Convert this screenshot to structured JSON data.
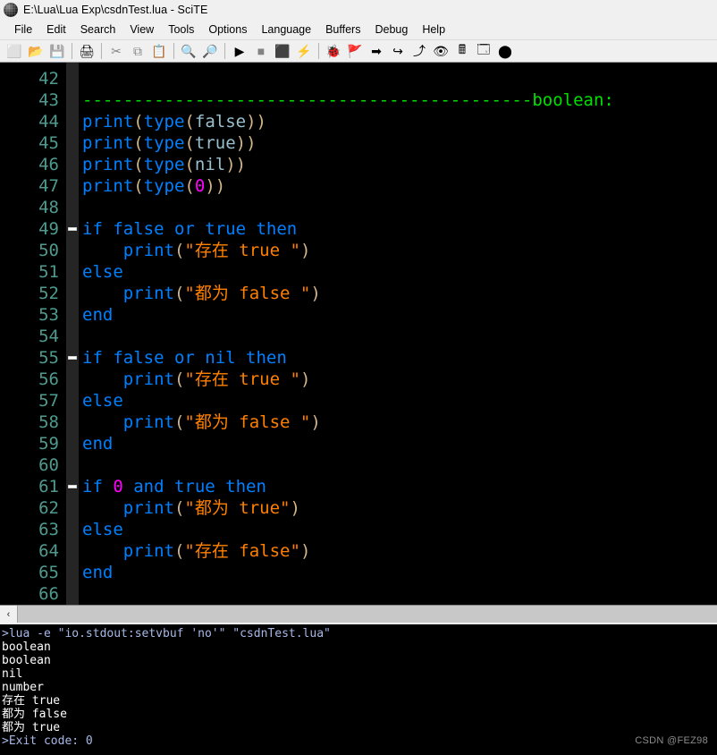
{
  "window": {
    "title": "E:\\Lua\\Lua Exp\\csdnTest.lua - SciTE",
    "app_icon": "sphere-icon"
  },
  "menubar": {
    "items": [
      {
        "label": "File"
      },
      {
        "label": "Edit"
      },
      {
        "label": "Search"
      },
      {
        "label": "View"
      },
      {
        "label": "Tools"
      },
      {
        "label": "Options"
      },
      {
        "label": "Language"
      },
      {
        "label": "Buffers"
      },
      {
        "label": "Debug"
      },
      {
        "label": "Help"
      }
    ]
  },
  "toolbar": {
    "buttons": [
      {
        "name": "new-file-icon",
        "glyph": "⬜",
        "disabled": false
      },
      {
        "name": "open-file-icon",
        "glyph": "📂",
        "disabled": false
      },
      {
        "name": "save-file-icon",
        "glyph": "💾",
        "disabled": true
      },
      {
        "name": "print-icon",
        "glyph": "🖨",
        "disabled": false
      },
      {
        "name": "cut-icon",
        "glyph": "✂",
        "disabled": true
      },
      {
        "name": "copy-icon",
        "glyph": "⧉",
        "disabled": true
      },
      {
        "name": "paste-icon",
        "glyph": "📋",
        "disabled": false
      },
      {
        "name": "find-icon",
        "glyph": "🔍",
        "disabled": false
      },
      {
        "name": "replace-icon",
        "glyph": "🔎",
        "disabled": false
      },
      {
        "name": "run-icon",
        "glyph": "▶",
        "disabled": false
      },
      {
        "name": "stop-icon",
        "glyph": "■",
        "disabled": true
      },
      {
        "name": "console-icon",
        "glyph": "⬛",
        "disabled": false
      },
      {
        "name": "build-icon",
        "glyph": "⚡",
        "disabled": false
      },
      {
        "name": "debug-start-icon",
        "glyph": "🐞",
        "disabled": false
      },
      {
        "name": "breakpoint-icon",
        "glyph": "🚩",
        "disabled": false
      },
      {
        "name": "step-into-icon",
        "glyph": "➡",
        "disabled": false
      },
      {
        "name": "step-over-icon",
        "glyph": "↪",
        "disabled": false
      },
      {
        "name": "step-out-icon",
        "glyph": "⤴",
        "disabled": false
      },
      {
        "name": "watch-icon",
        "glyph": "👁",
        "disabled": false
      },
      {
        "name": "calculator-icon",
        "glyph": "🖩",
        "disabled": false
      },
      {
        "name": "export-window-icon",
        "glyph": "🗔",
        "disabled": false
      },
      {
        "name": "debug-stop-icon",
        "glyph": "⬤",
        "disabled": false
      }
    ]
  },
  "editor": {
    "first_line": 42,
    "last_line": 66,
    "line_numbers": [
      42,
      43,
      44,
      45,
      46,
      47,
      48,
      49,
      50,
      51,
      52,
      53,
      54,
      55,
      56,
      57,
      58,
      59,
      60,
      61,
      62,
      63,
      64,
      65,
      66
    ],
    "fold_lines": [
      49,
      55,
      61
    ],
    "colors": {
      "background": "#000000",
      "line_number": "#4e9a8f",
      "fold_margin": "#252525",
      "keyword": "#0080ff",
      "punctuation": "#d4b68a",
      "literal": "#9ac0cd",
      "number": "#ff00ff",
      "string": "#ff8000",
      "comment": "#00e000"
    },
    "lines": [
      {
        "num": 42,
        "tokens": []
      },
      {
        "num": 43,
        "tokens": [
          {
            "t": "comment",
            "s": "--------------------------------------------boolean:"
          }
        ]
      },
      {
        "num": 44,
        "tokens": [
          {
            "t": "id",
            "s": "print"
          },
          {
            "t": "punc",
            "s": "("
          },
          {
            "t": "id",
            "s": "type"
          },
          {
            "t": "punc",
            "s": "("
          },
          {
            "t": "literal",
            "s": "false"
          },
          {
            "t": "punc",
            "s": "))"
          }
        ]
      },
      {
        "num": 45,
        "tokens": [
          {
            "t": "id",
            "s": "print"
          },
          {
            "t": "punc",
            "s": "("
          },
          {
            "t": "id",
            "s": "type"
          },
          {
            "t": "punc",
            "s": "("
          },
          {
            "t": "literal",
            "s": "true"
          },
          {
            "t": "punc",
            "s": "))"
          }
        ]
      },
      {
        "num": 46,
        "tokens": [
          {
            "t": "id",
            "s": "print"
          },
          {
            "t": "punc",
            "s": "("
          },
          {
            "t": "id",
            "s": "type"
          },
          {
            "t": "punc",
            "s": "("
          },
          {
            "t": "literal",
            "s": "nil"
          },
          {
            "t": "punc",
            "s": "))"
          }
        ]
      },
      {
        "num": 47,
        "tokens": [
          {
            "t": "id",
            "s": "print"
          },
          {
            "t": "punc",
            "s": "("
          },
          {
            "t": "id",
            "s": "type"
          },
          {
            "t": "punc",
            "s": "("
          },
          {
            "t": "num",
            "s": "0"
          },
          {
            "t": "punc",
            "s": "))"
          }
        ]
      },
      {
        "num": 48,
        "tokens": []
      },
      {
        "num": 49,
        "tokens": [
          {
            "t": "kw",
            "s": "if false or true then"
          }
        ]
      },
      {
        "num": 50,
        "tokens": [
          {
            "t": "plain",
            "s": "    "
          },
          {
            "t": "id",
            "s": "print"
          },
          {
            "t": "punc",
            "s": "("
          },
          {
            "t": "str",
            "s": "\"存在 true \""
          },
          {
            "t": "punc",
            "s": ")"
          }
        ]
      },
      {
        "num": 51,
        "tokens": [
          {
            "t": "kw",
            "s": "else"
          }
        ]
      },
      {
        "num": 52,
        "tokens": [
          {
            "t": "plain",
            "s": "    "
          },
          {
            "t": "id",
            "s": "print"
          },
          {
            "t": "punc",
            "s": "("
          },
          {
            "t": "str",
            "s": "\"都为 false \""
          },
          {
            "t": "punc",
            "s": ")"
          }
        ]
      },
      {
        "num": 53,
        "tokens": [
          {
            "t": "kw",
            "s": "end"
          }
        ]
      },
      {
        "num": 54,
        "tokens": []
      },
      {
        "num": 55,
        "tokens": [
          {
            "t": "kw",
            "s": "if false or nil then"
          }
        ]
      },
      {
        "num": 56,
        "tokens": [
          {
            "t": "plain",
            "s": "    "
          },
          {
            "t": "id",
            "s": "print"
          },
          {
            "t": "punc",
            "s": "("
          },
          {
            "t": "str",
            "s": "\"存在 true \""
          },
          {
            "t": "punc",
            "s": ")"
          }
        ]
      },
      {
        "num": 57,
        "tokens": [
          {
            "t": "kw",
            "s": "else"
          }
        ]
      },
      {
        "num": 58,
        "tokens": [
          {
            "t": "plain",
            "s": "    "
          },
          {
            "t": "id",
            "s": "print"
          },
          {
            "t": "punc",
            "s": "("
          },
          {
            "t": "str",
            "s": "\"都为 false \""
          },
          {
            "t": "punc",
            "s": ")"
          }
        ]
      },
      {
        "num": 59,
        "tokens": [
          {
            "t": "kw",
            "s": "end"
          }
        ]
      },
      {
        "num": 60,
        "tokens": []
      },
      {
        "num": 61,
        "tokens": [
          {
            "t": "kw",
            "s": "if "
          },
          {
            "t": "num",
            "s": "0"
          },
          {
            "t": "kw",
            "s": " and true then"
          }
        ]
      },
      {
        "num": 62,
        "tokens": [
          {
            "t": "plain",
            "s": "    "
          },
          {
            "t": "id",
            "s": "print"
          },
          {
            "t": "punc",
            "s": "("
          },
          {
            "t": "str",
            "s": "\"都为 true\""
          },
          {
            "t": "punc",
            "s": ")"
          }
        ]
      },
      {
        "num": 63,
        "tokens": [
          {
            "t": "kw",
            "s": "else"
          }
        ]
      },
      {
        "num": 64,
        "tokens": [
          {
            "t": "plain",
            "s": "    "
          },
          {
            "t": "id",
            "s": "print"
          },
          {
            "t": "punc",
            "s": "("
          },
          {
            "t": "str",
            "s": "\"存在 false\""
          },
          {
            "t": "punc",
            "s": ")"
          }
        ]
      },
      {
        "num": 65,
        "tokens": [
          {
            "t": "kw",
            "s": "end"
          }
        ]
      },
      {
        "num": 66,
        "tokens": []
      }
    ]
  },
  "scrollbar": {
    "left_arrow": "‹"
  },
  "console": {
    "lines": [
      {
        "kind": "cmd",
        "text": ">lua -e \"io.stdout:setvbuf 'no'\" \"csdnTest.lua\""
      },
      {
        "kind": "out",
        "text": "boolean"
      },
      {
        "kind": "out",
        "text": "boolean"
      },
      {
        "kind": "out",
        "text": "nil"
      },
      {
        "kind": "out",
        "text": "number"
      },
      {
        "kind": "out",
        "text": "存在 true"
      },
      {
        "kind": "out",
        "text": "都为 false"
      },
      {
        "kind": "out",
        "text": "都为 true"
      },
      {
        "kind": "cmd",
        "text": ">Exit code: 0"
      }
    ]
  },
  "watermark": {
    "text": "CSDN @FEZ98"
  }
}
